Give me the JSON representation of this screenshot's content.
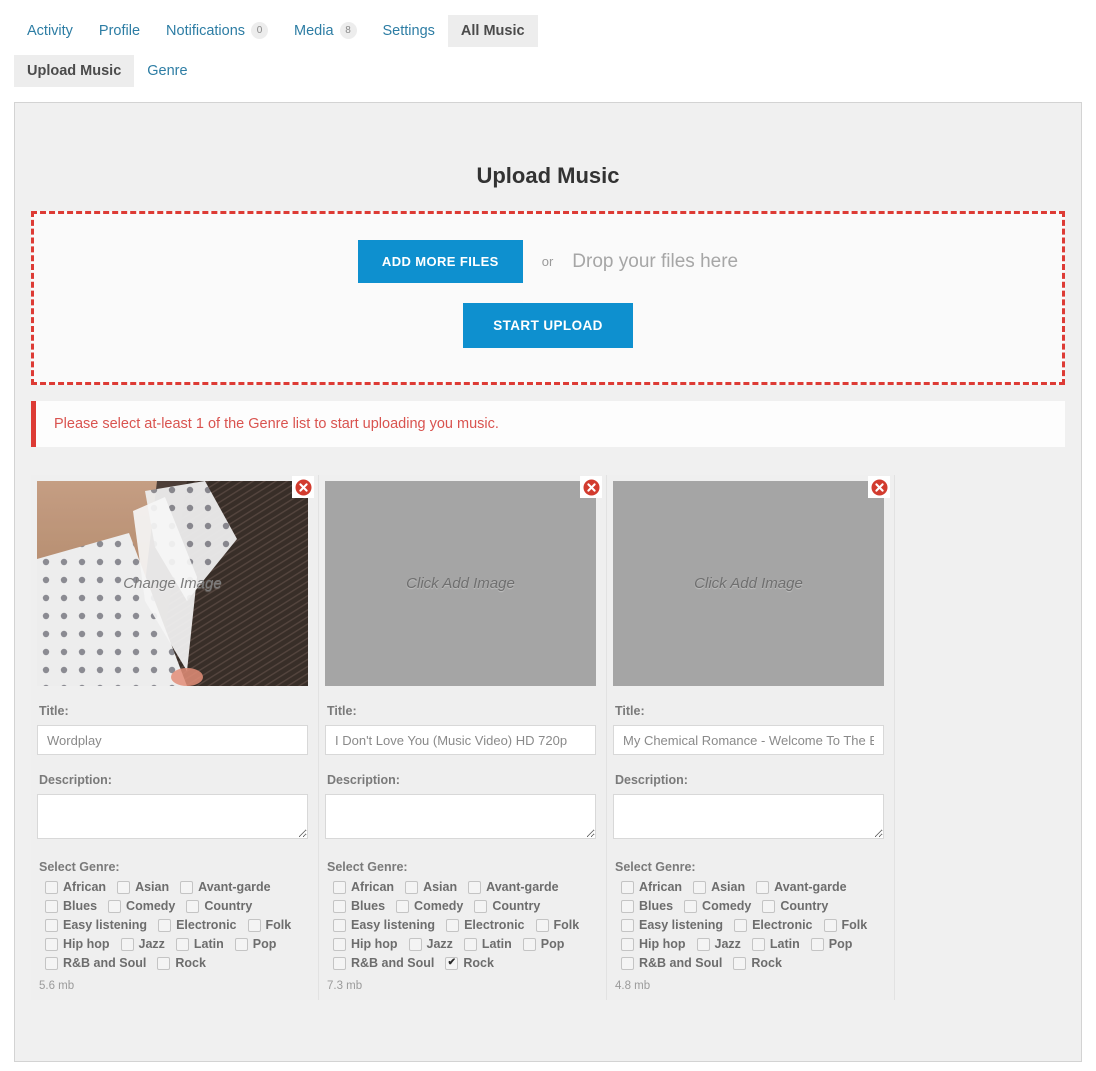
{
  "nav": {
    "primary": [
      {
        "label": "Activity",
        "badge": null,
        "active": false
      },
      {
        "label": "Profile",
        "badge": null,
        "active": false
      },
      {
        "label": "Notifications",
        "badge": "0",
        "active": false
      },
      {
        "label": "Media",
        "badge": "8",
        "active": false
      },
      {
        "label": "Settings",
        "badge": null,
        "active": false
      },
      {
        "label": "All Music",
        "badge": null,
        "active": true
      }
    ],
    "secondary": [
      {
        "label": "Upload Music",
        "active": true
      },
      {
        "label": "Genre",
        "active": false
      }
    ]
  },
  "page": {
    "title": "Upload Music"
  },
  "dropzone": {
    "add_files_label": "ADD MORE FILES",
    "or_label": "or",
    "drop_hint": "Drop your files here",
    "start_upload_label": "START UPLOAD",
    "border_color": "#dd3b35"
  },
  "alert": {
    "message": "Please select at-least 1 of the Genre list to start uploading you music.",
    "color": "#d9534f"
  },
  "labels": {
    "title": "Title:",
    "description": "Description:",
    "select_genre": "Select Genre:",
    "remove_icon": "remove-icon"
  },
  "genres": [
    "African",
    "Asian",
    "Avant-garde",
    "Blues",
    "Comedy",
    "Country",
    "Easy listening",
    "Electronic",
    "Folk",
    "Hip hop",
    "Jazz",
    "Latin",
    "Pop",
    "R&B and Soul",
    "Rock"
  ],
  "cards": [
    {
      "image_label": "Change Image",
      "has_photo": true,
      "title_value": "Wordplay",
      "description_value": "",
      "checked_genres": [],
      "filesize": "5.6 mb"
    },
    {
      "image_label": "Click Add Image",
      "has_photo": false,
      "title_value": "I Don't Love You (Music Video) HD 720p",
      "description_value": "",
      "checked_genres": [
        "Rock"
      ],
      "filesize": "7.3 mb"
    },
    {
      "image_label": "Click Add Image",
      "has_photo": false,
      "title_value": "My Chemical Romance - Welcome To The Black Parade",
      "description_value": "",
      "checked_genres": [],
      "filesize": "4.8 mb"
    }
  ],
  "colors": {
    "accent_blue": "#0e90cf",
    "alert_red": "#dd3b35",
    "link_blue": "#2d7da4"
  }
}
